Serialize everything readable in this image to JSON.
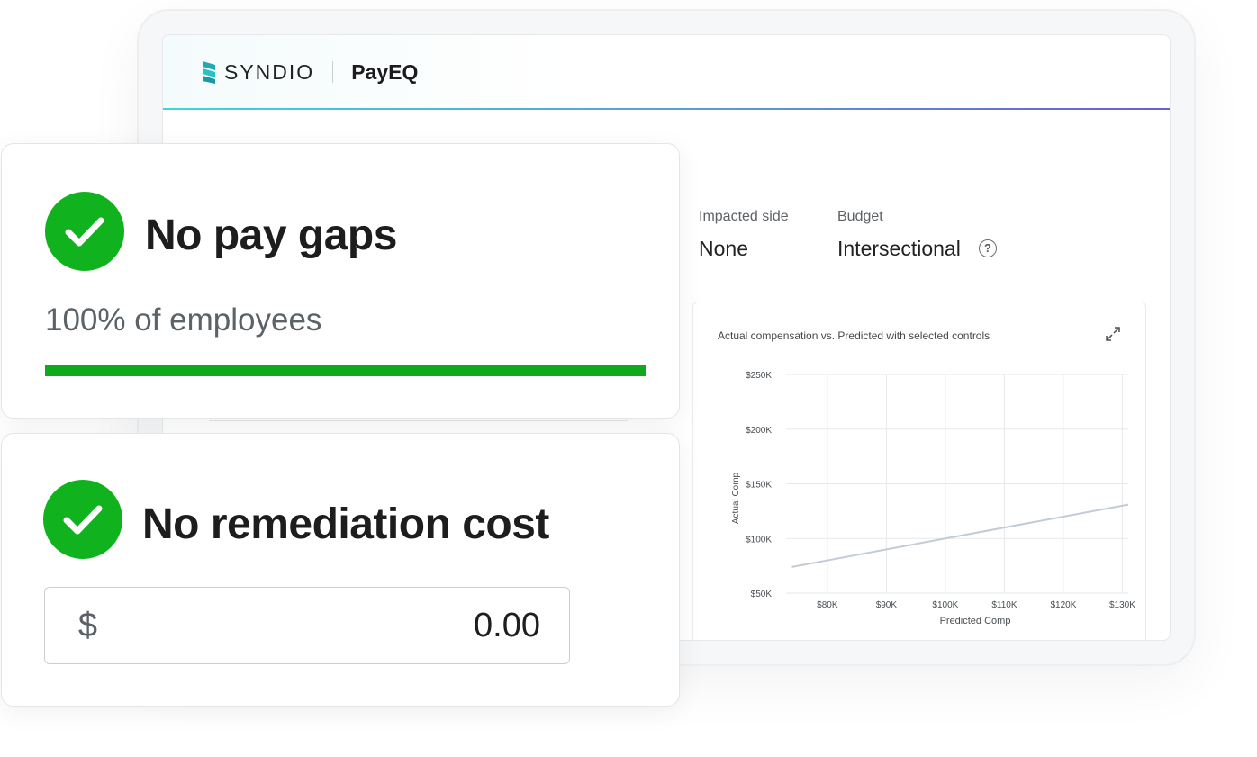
{
  "app": {
    "brand": "SYNDIO",
    "product": "PayEQ"
  },
  "summary": {
    "impacted_side_label": "Impacted side",
    "impacted_side_value": "None",
    "budget_label": "Budget",
    "budget_value": "Intersectional",
    "help_glyph": "?"
  },
  "chart": {
    "title": "Actual compensation vs. Predicted with selected controls"
  },
  "chart_data": {
    "type": "line",
    "title": "Actual compensation vs. Predicted with selected controls",
    "xlabel": "Predicted Comp",
    "ylabel": "Actual Comp",
    "x_ticks": [
      "$80K",
      "$90K",
      "$100K",
      "$110K",
      "$120K",
      "$130K"
    ],
    "y_ticks": [
      "$250K",
      "$200K",
      "$150K",
      "$100K",
      "$50K"
    ],
    "xlim": [
      73000,
      131000
    ],
    "ylim": [
      50000,
      250000
    ],
    "grid": true,
    "series": [
      {
        "x": [
          74000,
          131000
        ],
        "y": [
          74000,
          131000
        ]
      }
    ]
  },
  "card_gaps": {
    "title": "No pay gaps",
    "subtitle": "100% of employees",
    "progress_value": 100
  },
  "card_cost": {
    "title": "No remediation cost",
    "currency_symbol": "$",
    "amount": "0.00"
  },
  "colors": {
    "success": "#10b31e",
    "accent_teal": "#3fd5d5",
    "accent_purple": "#6a5ed0",
    "line": "#c3cbd4"
  }
}
